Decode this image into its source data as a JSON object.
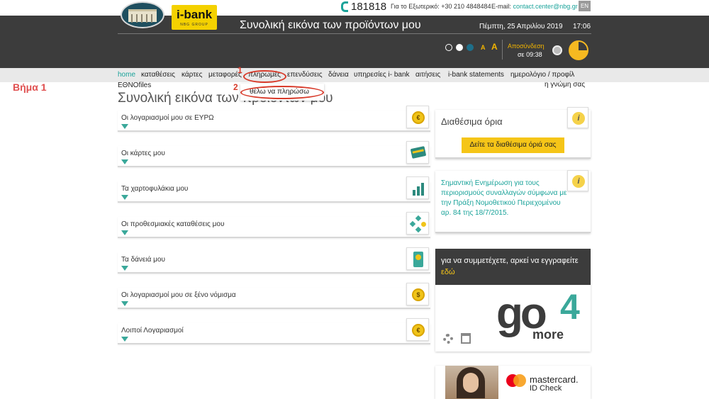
{
  "header": {
    "phone": "181818",
    "abroad": "Για το Εξωτερικό: +30 210 4848484",
    "email_label": "E-mail:",
    "email": "contact.center@nbg.gr",
    "lang": "EN",
    "ibank_logo": "i-bank",
    "ibank_sub": "NBG GROUP",
    "title": "Συνολική εικόνα των προϊόντων μου",
    "date": "Πέμπτη, 25 Απριλίου 2019",
    "time": "17:06",
    "font_small": "A",
    "font_large": "A",
    "logout": "Αποσύνδεση",
    "logout_timer": "σε 09:38"
  },
  "nav": {
    "items": [
      "home",
      "καταθέσεις",
      "κάρτες",
      "μεταφορές",
      "πληρωμές",
      "επενδύσεις",
      "δάνεια",
      "υπηρεσίες i- bank",
      "αιτήσεις",
      "i-bank statements",
      "ημερολόγιο / προφίλ"
    ],
    "sub": "ΕΘΝΟfiles",
    "opinion": "η γνώμη σας",
    "dropdown_item": "θέλω να πληρώσω"
  },
  "annotations": {
    "step": "Βήμα 1",
    "n1": "1",
    "n2": "2"
  },
  "page_title": "Συνολική εικόνα των προϊόντων μου",
  "accounts": [
    "Οι λογαριασμοί μου σε ΕΥΡΩ",
    "Οι κάρτες μου",
    "Τα χαρτοφυλάκια μου",
    "Οι προθεσμιακές καταθέσεις μου",
    "Τα δάνειά μου",
    "Οι λογαριασμοί μου σε ξένο νόμισμα",
    "Λοιποί Λογαριασμοί"
  ],
  "icons": [
    "euro-coin-icon",
    "card-icon",
    "portfolio-chart-icon",
    "transfer-arrows-icon",
    "loan-phone-icon",
    "dollar-coin-icon",
    "euro-coin-icon"
  ],
  "limits": {
    "title": "Διαθέσιμα όρια",
    "button": "Δείτε τα διαθέσιμα όριά σας"
  },
  "notice": "Σημαντική Ενημέρωση για τους περιορισμούς συναλλαγών σύμφωνα με την Πράξη Νομοθετικού Περιεχομένου αρ. 84 της 18/7/2015.",
  "promo": {
    "text": "για να συμμετέχετε, αρκεί να εγγραφείτε",
    "link": "εδώ",
    "logo_go": "go",
    "logo_4": "4",
    "logo_more": "more"
  },
  "mastercard": {
    "line1": "mastercard.",
    "line2": "ID Check"
  },
  "colors": {
    "accent": "#1aa39a",
    "yellow": "#f5c518",
    "dark": "#3c3c3c",
    "annotation_red": "#d83a2a"
  }
}
